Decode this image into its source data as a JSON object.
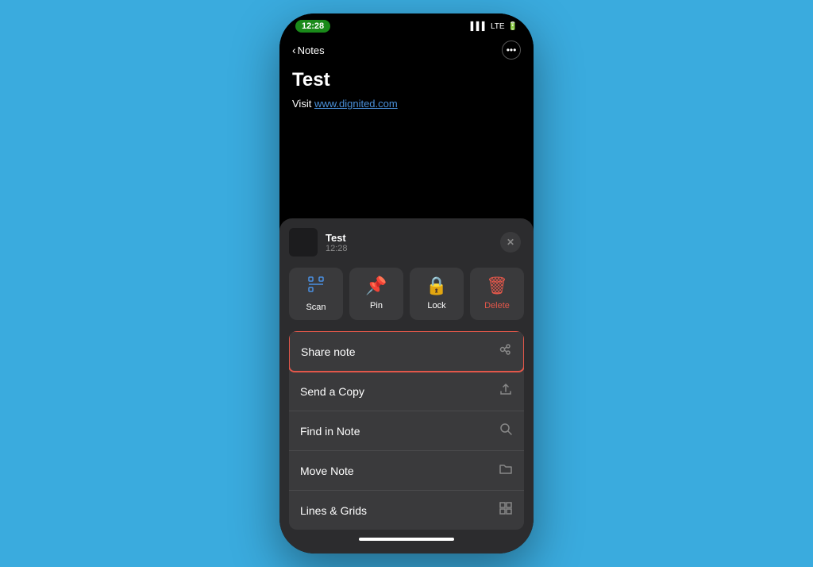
{
  "statusBar": {
    "time": "12:28",
    "carrier": "LTE",
    "batteryIcon": "🔋"
  },
  "header": {
    "backLabel": "Notes",
    "moreIcon": "···"
  },
  "note": {
    "title": "Test",
    "bodyPrefix": "Visit ",
    "link": "www.dignited.com"
  },
  "sheet": {
    "noteTitle": "Test",
    "noteTime": "12:28",
    "closeIcon": "✕"
  },
  "actionButtons": [
    {
      "id": "scan",
      "icon": "⊡",
      "label": "Scan",
      "iconClass": "action-icon-scan"
    },
    {
      "id": "pin",
      "icon": "📌",
      "label": "Pin",
      "iconClass": "action-icon-pin"
    },
    {
      "id": "lock",
      "icon": "🔒",
      "label": "Lock",
      "iconClass": "action-icon-lock"
    },
    {
      "id": "delete",
      "icon": "🗑",
      "label": "Delete",
      "iconClass": "action-icon-delete"
    }
  ],
  "menuItems": [
    {
      "id": "share-note",
      "label": "Share note",
      "icon": "👥",
      "highlighted": true
    },
    {
      "id": "send-copy",
      "label": "Send a Copy",
      "icon": "⬆",
      "highlighted": false
    },
    {
      "id": "find-in-note",
      "label": "Find in Note",
      "icon": "🔍",
      "highlighted": false
    },
    {
      "id": "move-note",
      "label": "Move Note",
      "icon": "📁",
      "highlighted": false
    },
    {
      "id": "lines-grids",
      "label": "Lines & Grids",
      "icon": "⊞",
      "highlighted": false
    }
  ]
}
